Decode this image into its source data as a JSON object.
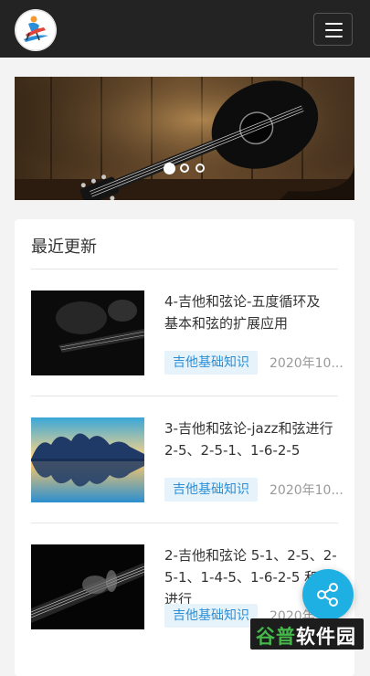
{
  "header": {
    "logo_icon": "guitar-player-logo-icon",
    "menu_icon": "hamburger-menu-icon"
  },
  "banner": {
    "image": "acoustic-guitar-on-wooden-wall",
    "slides": 3,
    "active_slide": 1
  },
  "latest": {
    "title": "最近更新",
    "items": [
      {
        "title_line1": "4-吉他和弦论-五度循环及",
        "title_line2": "基本和弦的扩展应用",
        "tag": "吉他基础知识",
        "date": "2020年10...",
        "thumb": "guitarist-dark-thumbnail"
      },
      {
        "title_line1": "3-吉他和弦论-jazz和弦进行",
        "title_line2": "2-5、2-5-1、1-6-2-5",
        "tag": "吉他基础知识",
        "date": "2020年10...",
        "thumb": "guitar-trees-reflection-thumbnail"
      },
      {
        "title_line1": "2-吉他和弦论 5-1、2-5、2-",
        "title_line2": "5-1、1-4-5、1-6-2-5 和弦",
        "title_line3": "进行",
        "tag": "吉他基础知识",
        "date": "2020年10...",
        "thumb": "guitar-neck-dark-thumbnail"
      }
    ]
  },
  "share": {
    "icon": "share-icon"
  },
  "watermark": {
    "part1": "谷普",
    "part2": "软件园"
  },
  "colors": {
    "header_bg": "#232323",
    "accent": "#1fb0e3",
    "tag_text": "#2a8fd8",
    "tag_bg": "#e6f3fb"
  }
}
